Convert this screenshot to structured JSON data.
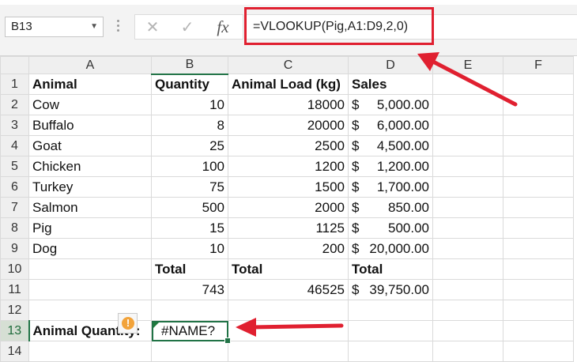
{
  "formula_bar": {
    "name_box": "B13",
    "cancel_icon": "✕",
    "enter_icon": "✓",
    "fx_label": "fx",
    "formula": "=VLOOKUP(Pig,A1:D9,2,0)"
  },
  "sheet": {
    "columns": [
      "A",
      "B",
      "C",
      "D",
      "E",
      "F"
    ],
    "rows": [
      {
        "n": "1",
        "a": "Animal",
        "b": "Quantity",
        "c": "Animal Load (kg)",
        "d_cur": "",
        "d_val": "Sales"
      },
      {
        "n": "2",
        "a": "Cow",
        "b": "10",
        "c": "18000",
        "d_cur": "$",
        "d_val": "5,000.00"
      },
      {
        "n": "3",
        "a": "Buffalo",
        "b": "8",
        "c": "20000",
        "d_cur": "$",
        "d_val": "6,000.00"
      },
      {
        "n": "4",
        "a": "Goat",
        "b": "25",
        "c": "2500",
        "d_cur": "$",
        "d_val": "4,500.00"
      },
      {
        "n": "5",
        "a": "Chicken",
        "b": "100",
        "c": "1200",
        "d_cur": "$",
        "d_val": "1,200.00"
      },
      {
        "n": "6",
        "a": "Turkey",
        "b": "75",
        "c": "1500",
        "d_cur": "$",
        "d_val": "1,700.00"
      },
      {
        "n": "7",
        "a": "Salmon",
        "b": "500",
        "c": "2000",
        "d_cur": "$",
        "d_val": "850.00"
      },
      {
        "n": "8",
        "a": "Pig",
        "b": "15",
        "c": "1125",
        "d_cur": "$",
        "d_val": "500.00"
      },
      {
        "n": "9",
        "a": "Dog",
        "b": "10",
        "c": "200",
        "d_cur": "$",
        "d_val": "20,000.00"
      },
      {
        "n": "10",
        "a": "",
        "b": "Total",
        "c": "Total",
        "d_cur": "",
        "d_val": "Total"
      },
      {
        "n": "11",
        "a": "",
        "b": "743",
        "c": "46525",
        "d_cur": "$",
        "d_val": "39,750.00"
      },
      {
        "n": "12",
        "a": "",
        "b": "",
        "c": "",
        "d_cur": "",
        "d_val": ""
      },
      {
        "n": "13",
        "a": "Animal Quantity:",
        "b": "#NAME?",
        "c": "",
        "d_cur": "",
        "d_val": ""
      },
      {
        "n": "14",
        "a": "",
        "b": "",
        "c": "",
        "d_cur": "",
        "d_val": ""
      }
    ]
  },
  "warning_icon": "!",
  "colors": {
    "accent": "#217346",
    "highlight": "#e02030"
  }
}
